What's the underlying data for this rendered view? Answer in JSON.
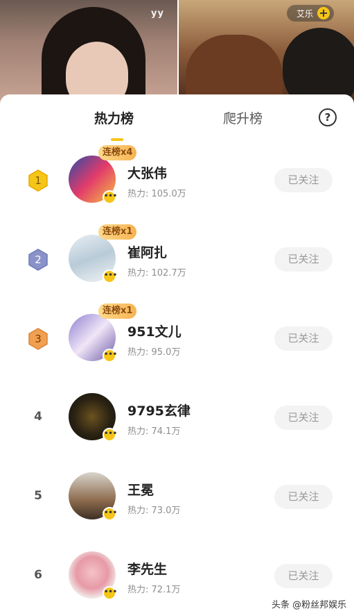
{
  "stream": {
    "watermark_logo": "yy",
    "anchor_name": "艾乐",
    "follow_plus": "+"
  },
  "tabs": {
    "active": "热力榜",
    "inactive": "爬升榜",
    "help": "?"
  },
  "rows": [
    {
      "rank": "1",
      "streak": "连榜x4",
      "name": "大张伟",
      "heat": "热力: 105.0万",
      "follow": "已关注"
    },
    {
      "rank": "2",
      "streak": "连榜x1",
      "name": "崔阿扎",
      "heat": "热力: 102.7万",
      "follow": "已关注"
    },
    {
      "rank": "3",
      "streak": "连榜x1",
      "name": "951文儿",
      "heat": "热力: 95.0万",
      "follow": "已关注"
    },
    {
      "rank": "4",
      "streak": "",
      "name": "9795玄律",
      "heat": "热力: 74.1万",
      "follow": "已关注"
    },
    {
      "rank": "5",
      "streak": "",
      "name": "王冕",
      "heat": "热力: 73.0万",
      "follow": "已关注"
    },
    {
      "rank": "6",
      "streak": "",
      "name": "李先生",
      "heat": "热力: 72.1万",
      "follow": "已关注"
    }
  ],
  "avatar_more": "•••",
  "badge_colors": {
    "gold": "#f5c518",
    "silver": "#8a93c9",
    "bronze": "#f0a050"
  },
  "footer_watermark": "头条 @粉丝邦娱乐"
}
